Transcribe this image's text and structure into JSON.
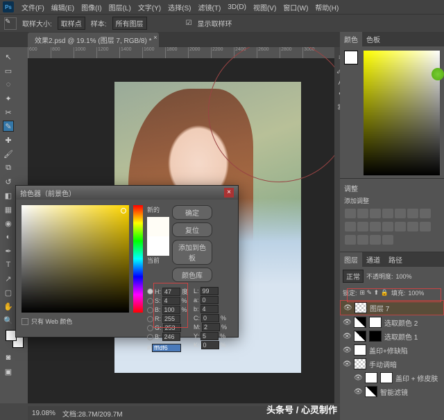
{
  "menu": {
    "file": "文件(F)",
    "edit": "编辑(E)",
    "image": "图像(I)",
    "layer": "图层(L)",
    "type": "文字(Y)",
    "select": "选择(S)",
    "filter": "滤镜(T)",
    "3d": "3D(D)",
    "view": "视图(V)",
    "window": "窗口(W)",
    "help": "帮助(H)"
  },
  "optbar": {
    "sample_label": "取样大小:",
    "sample": "取样点",
    "layer_label": "样本:",
    "layer": "所有图层",
    "ring": "显示取样环"
  },
  "doc": {
    "tab": "效果2.psd @ 19.1% (图层 7, RGB/8) *"
  },
  "ruler": [
    "600",
    "800",
    "1000",
    "1200",
    "1400",
    "1600",
    "1800",
    "2000",
    "2200",
    "2400",
    "2600",
    "2800",
    "3000"
  ],
  "picker": {
    "title": "拾色器（前景色）",
    "new_label": "新的",
    "cur_label": "当前",
    "ok": "确定",
    "reset": "复位",
    "add": "添加到色板",
    "lib": "颜色库",
    "H": "47",
    "S": "4",
    "B": "100",
    "R": "255",
    "G": "253",
    "Bv": "246",
    "L": "99",
    "a": "0",
    "b": "4",
    "C": "0",
    "M": "2",
    "Y": "5",
    "K": "0",
    "unit_deg": "度",
    "unit_pct": "%",
    "hex": "fffdf6",
    "web": "只有 Web 颜色"
  },
  "panels": {
    "color": "颜色",
    "swatch": "色板",
    "adjust": "调整",
    "layers": "图层",
    "channel": "通道",
    "path": "路径"
  },
  "layermode": {
    "normal": "正常",
    "opacity_lbl": "不透明度:",
    "opacity": "100%",
    "lock": "锁定:",
    "fill_lbl": "填充:",
    "fill": "100%"
  },
  "layers_list": [
    {
      "name": "图层 7",
      "sel": true,
      "thumb": "tr"
    },
    {
      "name": "选取颜色 2",
      "thumb": "bw",
      "mask": true
    },
    {
      "name": "选取颜色 1",
      "thumb": "bw",
      "mask": true,
      "mm": "m"
    },
    {
      "name": "盖印+修缺陷",
      "thumb": "w"
    },
    {
      "name": "手动调暗",
      "thumb": "tr"
    },
    {
      "name": "盖印 + 修皮肤",
      "thumb": "w",
      "mask": true,
      "indent": true
    },
    {
      "name": "智能滤镜",
      "thumb": "bw",
      "indent": true
    }
  ],
  "status": {
    "zoom": "19.08%",
    "doc": "文档:28.7M/209.7M"
  },
  "attrib": "头条号 / 心灵制作"
}
